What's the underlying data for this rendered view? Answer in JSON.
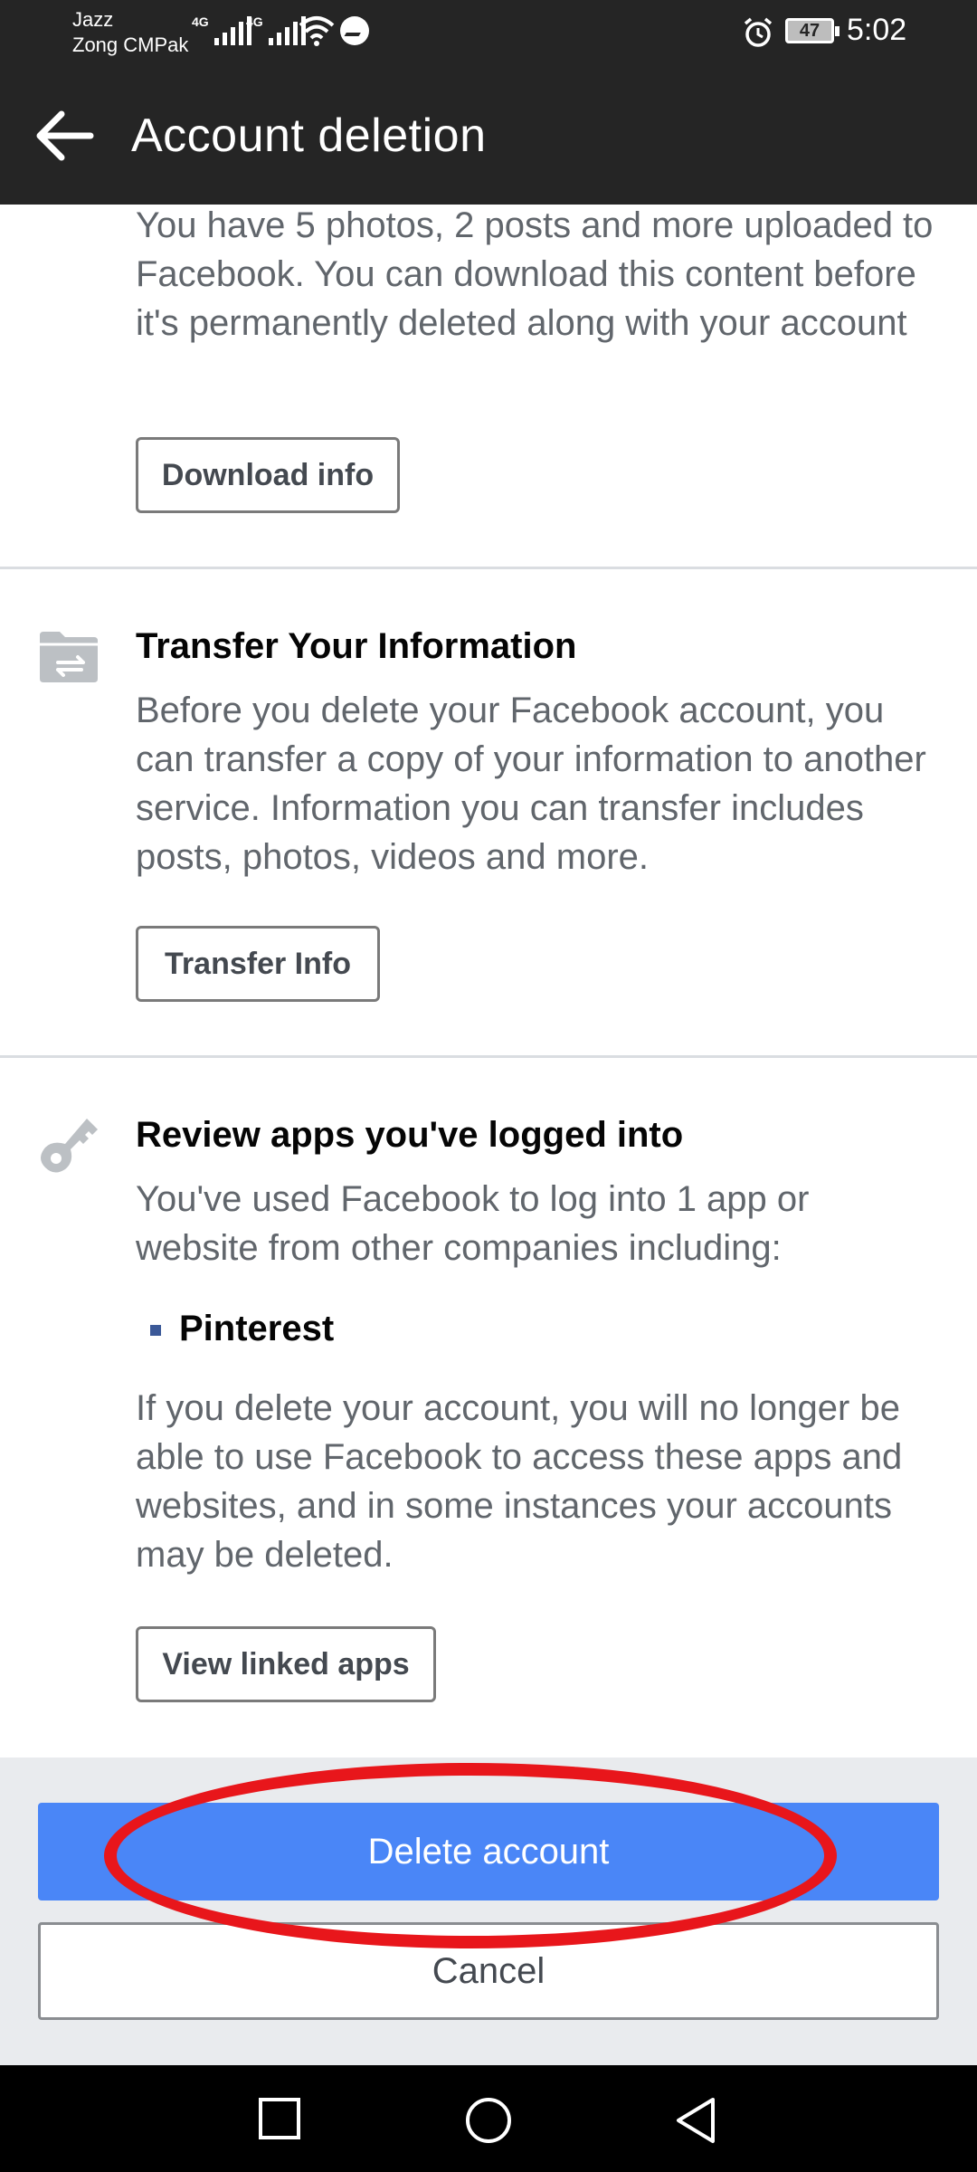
{
  "status_bar": {
    "carrier_1": "Jazz",
    "carrier_2": "Zong CMPak",
    "network_1": "4G",
    "network_2": "4G",
    "battery": "47",
    "time": "5:02"
  },
  "app_bar": {
    "title": "Account deletion"
  },
  "download_section": {
    "text": "You have 5 photos, 2 posts and more uploaded to Facebook. You can download this content before it's permanently deleted along with your account",
    "button_label": "Download info"
  },
  "transfer_section": {
    "heading": "Transfer Your Information",
    "text": "Before you delete your Facebook account, you can transfer a copy of your information to another service. Information you can transfer includes posts, photos, videos and more.",
    "button_label": "Transfer Info"
  },
  "apps_section": {
    "heading": "Review apps you've logged into",
    "text": "You've used Facebook to log into 1 app or website from other companies including:",
    "apps": [
      "Pinterest"
    ],
    "warning": "If you delete your account, you will no longer be able to use Facebook to access these apps and websites, and in some instances your accounts may be deleted.",
    "button_label": "View linked apps"
  },
  "actions": {
    "delete_label": "Delete account",
    "cancel_label": "Cancel"
  },
  "colors": {
    "delete_button": "#4a86f7",
    "annotation_ring": "#e8161b",
    "app_bar": "#252525"
  },
  "icons": {
    "transfer": "folder-transfer-icon",
    "apps": "key-icon"
  }
}
